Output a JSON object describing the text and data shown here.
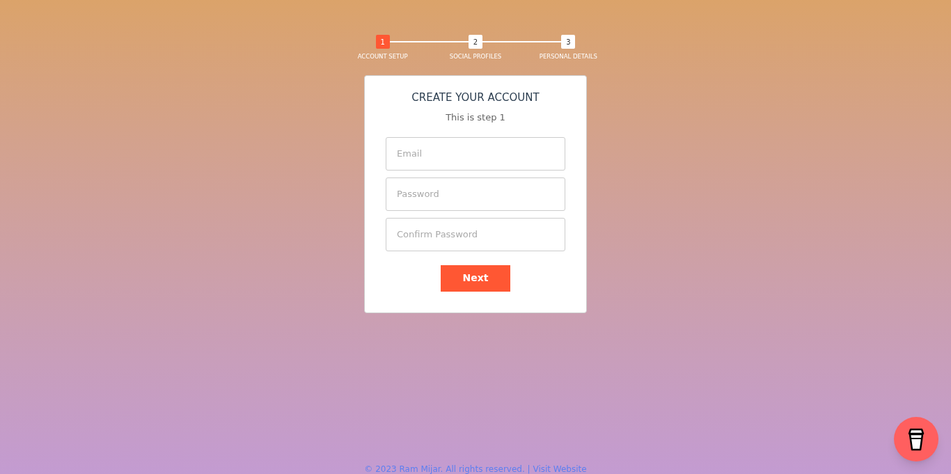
{
  "steps": [
    {
      "number": "1",
      "label": "ACCOUNT SETUP",
      "selected": true
    },
    {
      "number": "2",
      "label": "SOCIAL PROFILES",
      "selected": false
    },
    {
      "number": "3",
      "label": "PERSONAL DETAILS",
      "selected": false
    }
  ],
  "card": {
    "title": "CREATE YOUR ACCOUNT",
    "subtitle": "This is step 1",
    "fields": [
      {
        "placeholder": "Email"
      },
      {
        "placeholder": "Password"
      },
      {
        "placeholder": "Confirm Password"
      }
    ],
    "button": "Next"
  },
  "footer": {
    "text": "© 2023 Ram Mijar. All rights reserved. |",
    "link": "Visit Website"
  }
}
